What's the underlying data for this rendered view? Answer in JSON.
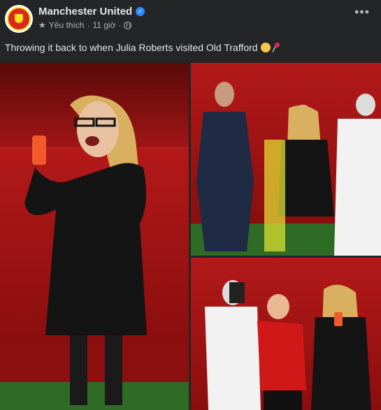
{
  "post": {
    "page_name": "Manchester United",
    "meta": {
      "action": "Yêu thích",
      "time": "11 giờ",
      "separator": "·"
    },
    "caption": "Throwing it back to when Julia Roberts visited Old Trafford",
    "caption_emojis": [
      "grinning-face",
      "lollipop"
    ]
  },
  "icons": {
    "avatar": "manchester-united-crest",
    "verified": "verified-badge-icon",
    "liked": "star-icon",
    "audience": "globe-icon",
    "more": "more-icon"
  },
  "colors": {
    "background": "#242526",
    "text_primary": "#e4e6eb",
    "text_secondary": "#b0b3b8",
    "verified_blue": "#2d88ff",
    "club_red": "#da291c"
  },
  "photos": [
    {
      "name": "julia-roberts-phone-photo"
    },
    {
      "name": "julia-roberts-with-player-photo"
    },
    {
      "name": "julia-roberts-with-boy-photo"
    }
  ]
}
